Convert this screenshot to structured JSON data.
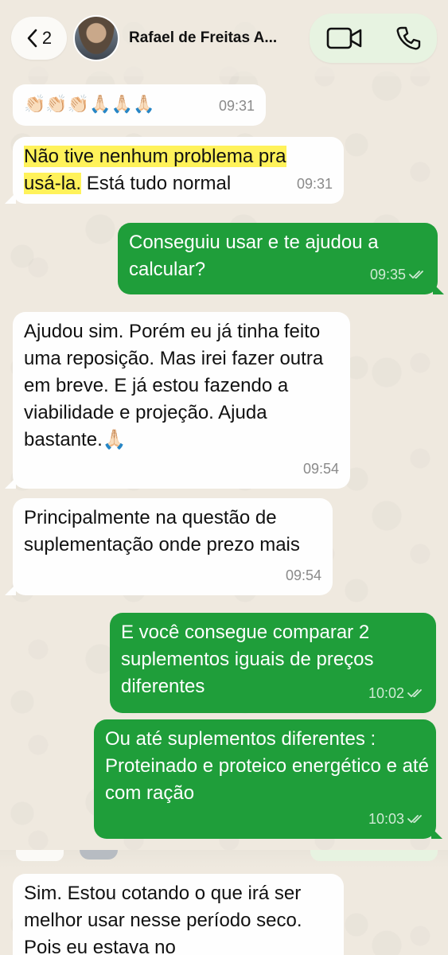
{
  "header": {
    "back_count": "2",
    "contact_name": "Rafael de Freitas A..."
  },
  "messages": [
    {
      "direction": "in",
      "text": "👏🏻👏🏻👏🏻🙏🏻🙏🏻🙏🏻",
      "time": "09:31"
    },
    {
      "direction": "in",
      "text_highlight_1": "Não tive nenhum problema pra",
      "text_highlight_2": "usá-la.",
      "text_rest": " Está tudo normal",
      "time": "09:31"
    },
    {
      "direction": "out",
      "text": "Conseguiu usar e te ajudou a calcular?",
      "time": "09:35"
    },
    {
      "direction": "in",
      "text": "Ajudou sim. Porém eu já tinha feito uma reposição. Mas irei fazer outra em breve. E já estou fazendo a viabilidade e projeção. Ajuda bastante.🙏🏻",
      "time": "09:54"
    },
    {
      "direction": "in",
      "text": "Principalmente na questão de suplementação onde prezo mais",
      "time": "09:54"
    },
    {
      "direction": "out",
      "text": "E você consegue comparar 2 suplementos iguais de preços diferentes",
      "time": "10:02"
    },
    {
      "direction": "out",
      "text": "Ou até suplementos diferentes : Proteinado e proteico energético e até com ração",
      "time": "10:03"
    },
    {
      "direction": "in",
      "text": "Sim. Estou cotando o que irá ser melhor usar nesse período seco. Pois eu estava no"
    }
  ],
  "colors": {
    "outgoing_bubble": "#1f9e3a",
    "incoming_bubble": "#fefefe",
    "highlight": "#fff25a",
    "wallpaper": "#efe9df"
  },
  "icons": {
    "back": "chevron-left-icon",
    "video": "video-camera-icon",
    "call": "phone-icon",
    "read": "double-check-icon"
  }
}
